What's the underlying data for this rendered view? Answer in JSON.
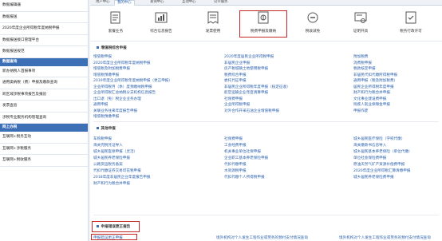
{
  "sidebar": {
    "items_top": [
      "数据编辑器",
      "数据报送",
      "2020年度企业所得税年度纳税申报",
      "数据报送接口管理平台",
      "数据报送规范"
    ],
    "header1": "数据查询",
    "items_mid": [
      "新办纳税人首报事项",
      "通用类纳税（费）申报及缴款查询",
      "跨区域涉税事项报告及报验",
      "发票查验",
      "涉税专业服务机构管理查询"
    ],
    "header2": "网上办税",
    "items_bottom": [
      "互联网+税务互动",
      "互联网+涉税服务",
      "互联网+税收服务"
    ]
  },
  "tabs": [
    {
      "label": "用户中心",
      "active": false
    },
    {
      "label": "我的中心",
      "active": true
    },
    {
      "label": "查询中心",
      "active": false
    },
    {
      "label": "互动中心",
      "active": false
    },
    {
      "label": "公众服务",
      "active": false
    }
  ],
  "icons": [
    {
      "label": "套餐业务",
      "icon": "doc-icon"
    },
    {
      "label": "综合信息报告",
      "icon": "report-icon"
    },
    {
      "label": "发票使用",
      "icon": "invoice-icon"
    },
    {
      "label": "税费申报及缴纳",
      "icon": "tax-filing-icon"
    },
    {
      "label": "税收减免",
      "icon": "reduction-icon"
    },
    {
      "label": "证明开具",
      "icon": "certificate-icon"
    },
    {
      "label": "税务行政许可",
      "icon": "license-icon"
    }
  ],
  "section1": {
    "title": "增值税综合申报",
    "col1": [
      "增值税申报",
      "2020年度企业所得税年度纳税申报",
      "增值税及附加税费申报",
      "增值税预缴申报",
      "2019年度企业所得税年度纳税申报（更正申报）",
      "企业所得税月（季）度预缴纳税申报",
      "企业所得税汇总纳税分支机构信息报告",
      "出口退（免）税企业业务办理",
      "通用申报",
      "关联业务往来年度报告申报",
      "增值税预缴申报"
    ],
    "col2": [
      "2020年度居民企业所得税申报",
      "非居民企业申报",
      "房产税城镇土地使用税申报",
      "税费综合申报",
      "委托代征申报",
      "非居民企业所得税年度申报（核定征收）",
      "航空运输企业年度清算申报",
      "社保费申报",
      "企业所得税申报",
      "对外合作开采石油企业增值税申报"
    ],
    "col3": [
      "附加税费",
      "消费税申报",
      "税款核定申报",
      "非居民代扣代缴所得税申报",
      "通用申报（税及附加税费）",
      "居民企业所得税年度申报",
      "财产和行为税合并申报",
      "文化事业建设费申报",
      "残疾人就业保障金申报",
      "申报作废"
    ]
  },
  "section2": {
    "title": "其他申报",
    "col1": [
      "车购税申报",
      "海关完税凭证导入",
      "城乡居民医保申报（灵活）",
      "城乡居民养老保险申报",
      "公路货运税务备案",
      "代扣代缴证券交易印花税申报",
      "2018年度非居民企业年度报告申报",
      "财产和行为税合并申报"
    ],
    "col2": [
      "社保费申报",
      "工会经费申报",
      "机关事业单位社保申报",
      "企业职工基本养老保险申报",
      "代扣代缴申报",
      "水资源税申报",
      "代扣代缴个人所得税申报"
    ],
    "col3": [
      "城乡居民医疗保险（学校代缴）",
      "海关缴款书信息导入",
      "城乡居民基本养老保险（单位代缴）",
      "单位社会保险费申报",
      "原油天然气矿产资源补偿费申报",
      "2020年度企业所得税汇算清缴申报",
      "城乡居民养老保险费申报"
    ]
  },
  "section3": {
    "title": "申报错误更正报告",
    "link1": "申报错误更正申报",
    "link2": "境外机构对个人发生工程作业或劳务的预付支付情况查询",
    "link3": "境外机构对个人发生工程作业或劳务的预付支付情况查询"
  },
  "colors": {
    "accent": "#3d6fb6",
    "highlight": "#c62828",
    "link": "#2d62ad"
  }
}
